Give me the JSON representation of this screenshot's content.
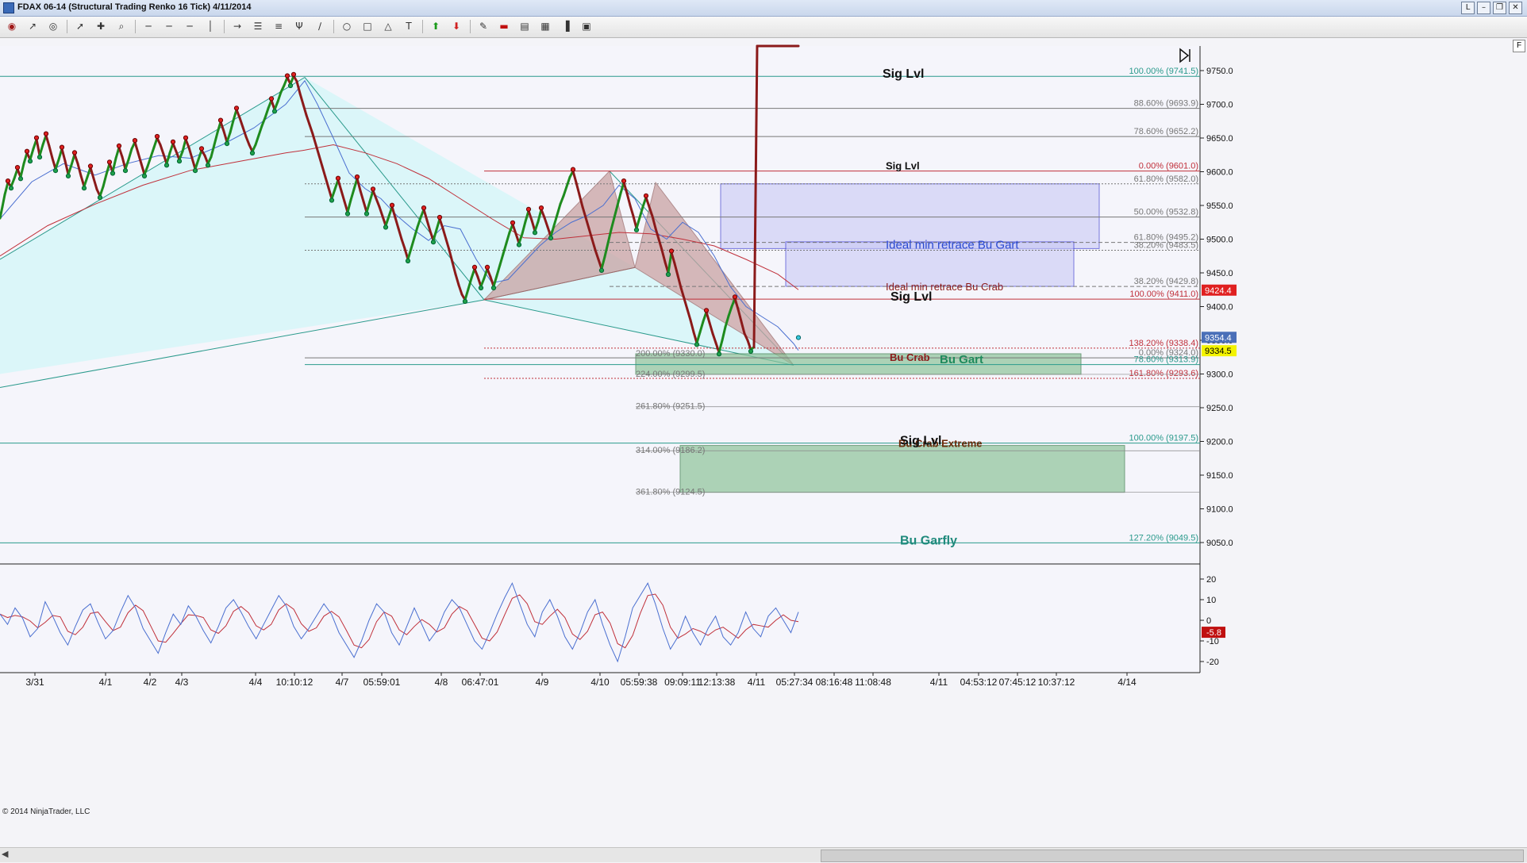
{
  "window": {
    "title": "FDAX 06-14 (Structural Trading Renko 16 Tick)  4/11/2014",
    "buttons": [
      "L",
      "–",
      "❐",
      "✕"
    ]
  },
  "toolbar": {
    "icons": [
      "eye-icon",
      "cursor-icon",
      "globe-icon",
      "pointer-icon",
      "crosshair-icon",
      "zoom-icon",
      "line-style-icon",
      "line-style-icon",
      "line-style-icon",
      "vertical-line-icon",
      "arrow-line-icon",
      "fib-retracement-icon",
      "fib-extension-icon",
      "andrews-pitchfork-icon",
      "fan-icon",
      "ellipse-icon",
      "rectangle-icon",
      "triangle-icon",
      "text-icon",
      "arrow-up-icon",
      "arrow-down-icon",
      "draw-objects-icon",
      "stop-icon",
      "data-box-icon",
      "chart-properties-icon",
      "bar-chart-icon",
      "order-icon"
    ]
  },
  "panel": {
    "f_button": "F",
    "copyright": "© 2014 NinjaTrader, LLC"
  },
  "colors": {
    "background": "#f4f4f8",
    "bull": "#1e8b1e",
    "bear": "#8b1a1a",
    "cyan_fill": "#d8f6f8",
    "pattern_fill": "#c9a3a3",
    "blue_zone": "#c9c9f5",
    "green_zone": "#8ec49a",
    "teal_line": "#2a9a8c",
    "red_line": "#c0303a",
    "text_teal": "#1f8a7c",
    "text_red": "#c0303a",
    "text_gray": "#777777"
  },
  "chart_data": {
    "type": "line",
    "title": "",
    "ylim": [
      9010,
      9790
    ],
    "y_ticks": [
      "9750.0",
      "9700.0",
      "9650.0",
      "9600.0",
      "9550.0",
      "9500.0",
      "9450.0",
      "9400.0",
      "9350.0",
      "9300.0",
      "9250.0",
      "9200.0",
      "9150.0",
      "9100.0",
      "9050.0"
    ],
    "x_ticks": [
      "3/31",
      "4/1",
      "4/2",
      "4/3",
      "4/4",
      "10:10:12",
      "4/7",
      "05:59:01",
      "4/8",
      "06:47:01",
      "4/9",
      "4/10",
      "05:59:38",
      "09:09:11",
      "12:13:38",
      "4/11",
      "05:27:34",
      "08:16:48",
      "11:08:48",
      "4/11",
      "04:53:12",
      "07:45:12",
      "10:37:12",
      "4/14"
    ],
    "price_tags": [
      {
        "value": 9424.4,
        "label": "9424.4",
        "color": "#e02020",
        "text_color": "#ffffff"
      },
      {
        "value": 9354.4,
        "label": "9354.4",
        "color": "#4a6fb8",
        "text_color": "#ffffff"
      },
      {
        "value": 9334.5,
        "label": "9334.5",
        "color": "#f3f300",
        "text_color": "#000000"
      }
    ],
    "price_series": {
      "name": "",
      "x": [
        0,
        3,
        6,
        10,
        14,
        18,
        22,
        26,
        30,
        34,
        38,
        42,
        46,
        50,
        54,
        58,
        62,
        66,
        70,
        74,
        78,
        82,
        86,
        90,
        94,
        98,
        102,
        106,
        110,
        114,
        118,
        122,
        126,
        130,
        134,
        138,
        142,
        146,
        150,
        154,
        158,
        162,
        166,
        170,
        174,
        178,
        182,
        186,
        190,
        194,
        198,
        202,
        206,
        210,
        214,
        218,
        222,
        226,
        230,
        234,
        238,
        242,
        246,
        250,
        254,
        258,
        262,
        266,
        270,
        274,
        278,
        282,
        286,
        290,
        294,
        298,
        302,
        306,
        310,
        314,
        318,
        322,
        326,
        330,
        334,
        338,
        342,
        346,
        350,
        354,
        358,
        362,
        366,
        370,
        374,
        378,
        382,
        386,
        390,
        394,
        398,
        402,
        406,
        410,
        414,
        418,
        422,
        426,
        430,
        434,
        438,
        442,
        446,
        450,
        454,
        458,
        462,
        466,
        470,
        474,
        478,
        482,
        486,
        490,
        494,
        498,
        502,
        506,
        510,
        514,
        518,
        522,
        526,
        530,
        534,
        538,
        542,
        546,
        550,
        554,
        558,
        562,
        566,
        570,
        574,
        578,
        582,
        586,
        590,
        594,
        598,
        602,
        606,
        610,
        614,
        618,
        622,
        626,
        630,
        634,
        638,
        642,
        646,
        650,
        654,
        658,
        662,
        666,
        670,
        674,
        678,
        682,
        686,
        690,
        694,
        698,
        702,
        706,
        710,
        714,
        718,
        722,
        726,
        730,
        734,
        738,
        742,
        746,
        750,
        754,
        758,
        762,
        766,
        770,
        774,
        778,
        782,
        786,
        790,
        794,
        798,
        802,
        806,
        810,
        814,
        818,
        822,
        826,
        830,
        834,
        838,
        842,
        846,
        850,
        854,
        858,
        862,
        866,
        870,
        874,
        878,
        882,
        886,
        890,
        894,
        898,
        902,
        906,
        910,
        914,
        918,
        922,
        926,
        930,
        934,
        938,
        942,
        946,
        950,
        954,
        958,
        962,
        966,
        970,
        974,
        978,
        982,
        986,
        990,
        994,
        998,
        1002,
        1006
      ],
      "y": [
        9531,
        9548,
        9566,
        9584,
        9578,
        9590,
        9604,
        9592,
        9612,
        9628,
        9618,
        9634,
        9648,
        9624,
        9640,
        9654,
        9638,
        9620,
        9604,
        9618,
        9634,
        9616,
        9596,
        9610,
        9626,
        9612,
        9594,
        9578,
        9592,
        9606,
        9590,
        9574,
        9564,
        9578,
        9596,
        9612,
        9600,
        9620,
        9636,
        9622,
        9604,
        9618,
        9634,
        9644,
        9628,
        9612,
        9596,
        9608,
        9622,
        9636,
        9650,
        9640,
        9626,
        9612,
        9628,
        9642,
        9630,
        9618,
        9630,
        9648,
        9636,
        9620,
        9604,
        9618,
        9632,
        9624,
        9612,
        9622,
        9640,
        9658,
        9674,
        9660,
        9644,
        9658,
        9676,
        9692,
        9680,
        9666,
        9652,
        9640,
        9630,
        9640,
        9654,
        9668,
        9680,
        9694,
        9706,
        9692,
        9704,
        9718,
        9728,
        9740,
        9730,
        9742,
        9734,
        9716,
        9700,
        9684,
        9670,
        9656,
        9640,
        9624,
        9608,
        9592,
        9576,
        9560,
        9574,
        9588,
        9572,
        9556,
        9540,
        9558,
        9574,
        9590,
        9572,
        9556,
        9540,
        9556,
        9572,
        9560,
        9548,
        9534,
        9520,
        9534,
        9548,
        9532,
        9516,
        9500,
        9486,
        9470,
        9486,
        9502,
        9518,
        9532,
        9544,
        9528,
        9512,
        9498,
        9514,
        9530,
        9516,
        9500,
        9484,
        9466,
        9448,
        9432,
        9418,
        9410,
        9426,
        9442,
        9456,
        9444,
        9430,
        9442,
        9456,
        9444,
        9430,
        9446,
        9462,
        9478,
        9494,
        9510,
        9522,
        9508,
        9494,
        9508,
        9526,
        9542,
        9528,
        9512,
        9526,
        9544,
        9532,
        9518,
        9504,
        9520,
        9536,
        9552,
        9564,
        9578,
        9592,
        9601,
        9584,
        9566,
        9548,
        9532,
        9516,
        9500,
        9484,
        9470,
        9456,
        9474,
        9494,
        9514,
        9532,
        9550,
        9568,
        9584,
        9568,
        9550,
        9534,
        9516,
        9532,
        9548,
        9562,
        9548,
        9534,
        9516,
        9500,
        9484,
        9466,
        9450,
        9480,
        9464,
        9446,
        9428,
        9412,
        9396,
        9380,
        9362,
        9346,
        9362,
        9378,
        9392,
        9376,
        9360,
        9346,
        9332,
        9350,
        9370,
        9386,
        9400,
        9412,
        9396,
        9378,
        9360,
        9350,
        9336,
        9340
      ]
    },
    "sma_fast": {
      "name": "",
      "x": [
        0,
        40,
        80,
        120,
        160,
        200,
        240,
        280,
        320,
        360,
        384,
        400,
        420,
        440,
        460,
        480,
        500,
        520,
        540,
        560,
        580,
        600,
        620,
        640,
        660,
        680,
        700,
        720,
        740,
        760,
        780,
        800,
        820,
        840,
        860,
        880,
        900,
        920,
        940,
        960,
        980,
        1000,
        1006
      ],
      "y": [
        9530,
        9585,
        9612,
        9595,
        9612,
        9624,
        9620,
        9640,
        9665,
        9700,
        9735,
        9700,
        9650,
        9598,
        9575,
        9560,
        9535,
        9515,
        9498,
        9520,
        9515,
        9470,
        9435,
        9440,
        9465,
        9490,
        9510,
        9525,
        9535,
        9550,
        9580,
        9560,
        9515,
        9500,
        9525,
        9510,
        9475,
        9430,
        9400,
        9385,
        9370,
        9345,
        9335
      ]
    },
    "sma_slow": {
      "name": "",
      "x": [
        0,
        60,
        120,
        180,
        240,
        300,
        360,
        384,
        420,
        460,
        500,
        540,
        580,
        620,
        660,
        700,
        740,
        780,
        820,
        860,
        900,
        940,
        980,
        1006
      ],
      "y": [
        9475,
        9520,
        9552,
        9580,
        9602,
        9615,
        9628,
        9632,
        9640,
        9628,
        9612,
        9590,
        9560,
        9530,
        9502,
        9500,
        9505,
        9510,
        9508,
        9500,
        9490,
        9470,
        9448,
        9425
      ]
    },
    "pivot_swings": {
      "x": [
        0,
        384,
        610,
        768,
        800,
        826,
        1000
      ],
      "y": [
        9470,
        9740,
        9410,
        9601,
        9458,
        9584,
        9313
      ]
    },
    "horizontal_levels": [
      {
        "value": 9741.5,
        "label": "100.00% (9741.5)",
        "color": "#2a9a8c"
      },
      {
        "value": 9693.9,
        "label": "88.60% (9693.9)",
        "color": "#777777"
      },
      {
        "value": 9652.2,
        "label": "78.60% (9652.2)",
        "color": "#777777"
      },
      {
        "value": 9601.0,
        "label": "0.00% (9601.0)",
        "color": "#c0303a"
      },
      {
        "value": 9582.0,
        "label": "61.80% (9582.0)",
        "color": "#777777"
      },
      {
        "value": 9532.8,
        "label": "50.00% (9532.8)",
        "color": "#777777"
      },
      {
        "value": 9495.2,
        "label": "61.80% (9495.2)",
        "color": "#777777"
      },
      {
        "value": 9483.5,
        "label": "38.20% (9483.5)",
        "color": "#777777"
      },
      {
        "value": 9429.8,
        "label": "38.20% (9429.8)",
        "color": "#777777"
      },
      {
        "value": 9411.0,
        "label": "100.00% (9411.0)",
        "color": "#c0303a"
      },
      {
        "value": 9338.4,
        "label": "138.20% (9338.4)",
        "color": "#c0303a"
      },
      {
        "value": 9324.0,
        "label": "0.00% (9324.0)",
        "color": "#777777"
      },
      {
        "value": 9313.9,
        "label": "78.60% (9313.9)",
        "color": "#2a9a8c"
      },
      {
        "value": 9293.6,
        "label": "161.80% (9293.6)",
        "color": "#c0303a"
      },
      {
        "value": 9197.5,
        "label": "100.00% (9197.5)",
        "color": "#2a9a8c"
      },
      {
        "value": 9049.5,
        "label": "127.20% (9049.5)",
        "color": "#2a9a8c"
      }
    ],
    "extension_labels": [
      {
        "value": 9330.0,
        "label": "200.00% (9330.0)"
      },
      {
        "value": 9299.5,
        "label": "224.00% (9299.5)"
      },
      {
        "value": 9251.5,
        "label": "261.80% (9251.5)"
      },
      {
        "value": 9186.2,
        "label": "314.00% (9186.2)"
      },
      {
        "value": 9124.5,
        "label": "361.80% (9124.5)"
      }
    ],
    "zones": [
      {
        "label": "Ideal min retrace Bu Gart",
        "y_from": 9486,
        "y_to": 9582,
        "kind": "blue"
      },
      {
        "label": "Ideal min retrace Bu Crab",
        "y_from": 9430,
        "y_to": 9496,
        "kind": "blue"
      },
      {
        "label": "Bu Gart",
        "y_from": 9299.5,
        "y_to": 9330,
        "kind": "green"
      },
      {
        "label": "Bu Crab Extreme",
        "y_from": 9124.5,
        "y_to": 9194,
        "kind": "green"
      }
    ],
    "annotations": [
      {
        "label": "Sig Lvl",
        "value": 9741.5
      },
      {
        "label": "Sig Lvl",
        "value": 9601.0
      },
      {
        "label": "Sig Lvl",
        "value": 9411.0
      },
      {
        "label": "Sig Lvl",
        "value": 9197.5
      },
      {
        "label": "Bu Crab",
        "value": 9317
      },
      {
        "label": "Bu Garfly",
        "value": 9049.5
      }
    ],
    "oscillator": {
      "ylim": [
        -23,
        24
      ],
      "y_ticks": [
        "20",
        "10",
        "0",
        "-10",
        "-20"
      ],
      "current_label": "-5.8",
      "fast": [
        3,
        -2,
        6,
        1,
        -8,
        -4,
        9,
        2,
        -6,
        -12,
        -3,
        5,
        8,
        -1,
        -9,
        -5,
        4,
        12,
        6,
        -4,
        -10,
        -16,
        -6,
        3,
        -2,
        7,
        2,
        -5,
        -11,
        -3,
        6,
        10,
        4,
        -3,
        -9,
        -2,
        5,
        12,
        7,
        -3,
        -9,
        -4,
        2,
        8,
        3,
        -6,
        -12,
        -18,
        -10,
        0,
        8,
        4,
        -6,
        -12,
        -3,
        6,
        -2,
        -10,
        -5,
        4,
        10,
        6,
        -2,
        -10,
        -14,
        -6,
        3,
        11,
        18,
        8,
        -2,
        -8,
        4,
        10,
        2,
        -8,
        -14,
        -6,
        4,
        10,
        -2,
        -12,
        -20,
        -8,
        6,
        12,
        18,
        8,
        -4,
        -14,
        -8,
        2,
        -6,
        -12,
        -4,
        2,
        -8,
        -12,
        -6,
        4,
        -4,
        -8,
        2,
        6,
        0,
        -6,
        4
      ]
    },
    "series_names": []
  }
}
